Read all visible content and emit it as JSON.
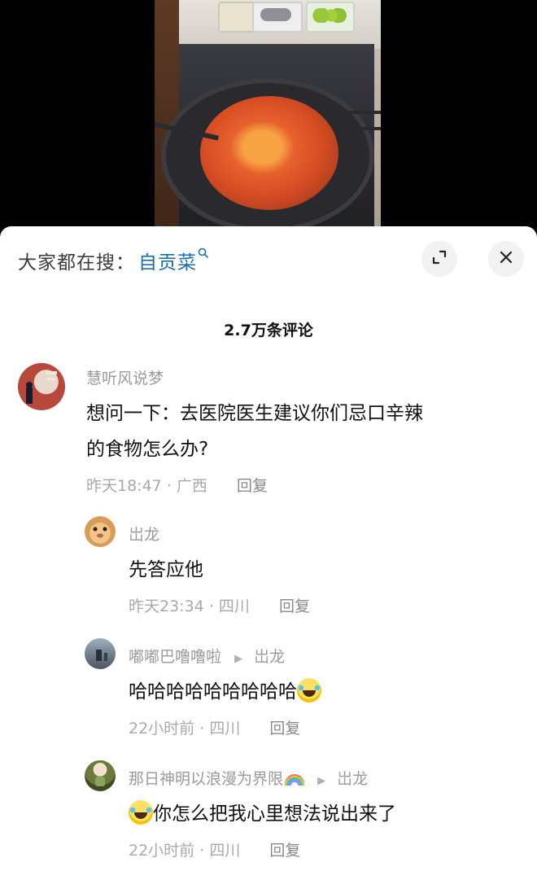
{
  "search": {
    "label": "大家都在搜：",
    "term": "自贡菜",
    "term_icon": "search-icon"
  },
  "controls": {
    "expand_icon": "expand-icon",
    "close_icon": "close-icon",
    "close_glyph": "✕"
  },
  "comments_header": {
    "count_text": "2.7万条评论"
  },
  "comments": [
    {
      "username": "慧听风说梦",
      "text_line1": "想问一下：去医院医生建议你们忌口辛辣",
      "text_line2": "的食物怎么办?",
      "time": "昨天18:47",
      "location": "广西",
      "reply_label": "回复"
    }
  ],
  "replies": [
    {
      "username": "岀龙",
      "reply_to": "",
      "text": "先答应他",
      "time": "昨天23:34",
      "location": "四川",
      "reply_label": "回复"
    },
    {
      "username": "嘟嘟巴噜噜啦",
      "reply_to": "岀龙",
      "text": "哈哈哈哈哈哈哈哈哈",
      "emoji": "laughing-crying-emoji",
      "time": "22小时前",
      "location": "四川",
      "reply_label": "回复"
    },
    {
      "username": "那日神明以浪漫为界限",
      "username_emoji": "rainbow-emoji",
      "reply_to": "岀龙",
      "text": "你怎么把我心里想法说出来了",
      "emoji": "laughing-crying-emoji",
      "time": "22小时前",
      "location": "四川",
      "reply_label": "回复"
    }
  ],
  "colors": {
    "link_blue": "#1f6ea8",
    "muted_gray": "#9a9a9a",
    "text_black": "#111111",
    "panel_bg": "#ffffff"
  }
}
